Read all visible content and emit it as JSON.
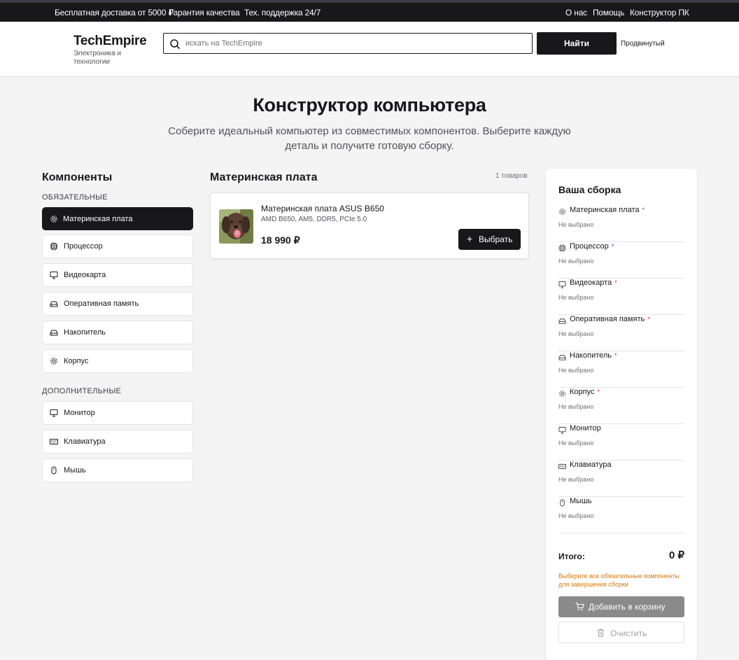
{
  "topbar": {
    "left": [
      "Бесплатная доставка от 5000 ₽",
      "Гарантия качества",
      "Тех. поддержка 24/7"
    ],
    "right": [
      "О нас",
      "Помощь",
      "Конструктор ПК"
    ]
  },
  "header": {
    "logo": "TechEmpire",
    "logo_sub": "Электроника и технологии",
    "search_placeholder": "искать на TechEmpire",
    "search_button": "Найти",
    "advanced": "Продвинутый"
  },
  "page": {
    "title": "Конструктор компьютера",
    "subtitle": "Соберите идеальный компьютер из совместимых компонентов. Выберите каждую деталь и получите готовую сборку."
  },
  "sidebar": {
    "title": "Компоненты",
    "required_label": "ОБЯЗАТЕЛЬНЫЕ",
    "optional_label": "ДОПОЛНИТЕЛЬНЫЕ",
    "required": [
      {
        "label": "Материнская плата",
        "icon": "gear-icon"
      },
      {
        "label": "Процессор",
        "icon": "cpu-icon"
      },
      {
        "label": "Видеокарта",
        "icon": "monitor-icon"
      },
      {
        "label": "Оперативная память",
        "icon": "drive-icon"
      },
      {
        "label": "Накопитель",
        "icon": "drive-icon"
      },
      {
        "label": "Корпус",
        "icon": "gear-icon"
      }
    ],
    "optional": [
      {
        "label": "Монитор",
        "icon": "monitor-icon"
      },
      {
        "label": "Клавиатура",
        "icon": "keyboard-icon"
      },
      {
        "label": "Мышь",
        "icon": "mouse-icon"
      }
    ]
  },
  "main": {
    "title": "Материнская плата",
    "count": "1 товаров",
    "products": [
      {
        "name": "Материнская плата ASUS B650",
        "spec": "AMD B650, AM5, DDR5, PCIe 5.0",
        "price": "18 990 ₽",
        "button": "Выбрать"
      }
    ]
  },
  "build": {
    "title": "Ваша сборка",
    "empty": "Не выбрано",
    "slots": [
      {
        "label": "Материнская плата",
        "required": true,
        "icon": "gear-icon"
      },
      {
        "label": "Процессор",
        "required": true,
        "icon": "cpu-icon"
      },
      {
        "label": "Видеокарта",
        "required": true,
        "icon": "monitor-icon"
      },
      {
        "label": "Оперативная память",
        "required": true,
        "icon": "drive-icon"
      },
      {
        "label": "Накопитель",
        "required": true,
        "icon": "drive-icon"
      },
      {
        "label": "Корпус",
        "required": true,
        "icon": "gear-icon"
      },
      {
        "label": "Монитор",
        "required": false,
        "icon": "monitor-icon"
      },
      {
        "label": "Клавиатура",
        "required": false,
        "icon": "keyboard-icon"
      },
      {
        "label": "Мышь",
        "required": false,
        "icon": "mouse-icon"
      }
    ],
    "total_label": "Итого:",
    "total_value": "0 ₽",
    "warning": "Выберите все обязательные компоненты для завершения сборки",
    "cart_button": "Добавить в корзину",
    "clear_button": "Очистить"
  },
  "colors": {
    "dark": "#18181b",
    "required_mark": "#dc2626",
    "warning": "#d97706",
    "disabled_button": "#8a8a8a"
  }
}
